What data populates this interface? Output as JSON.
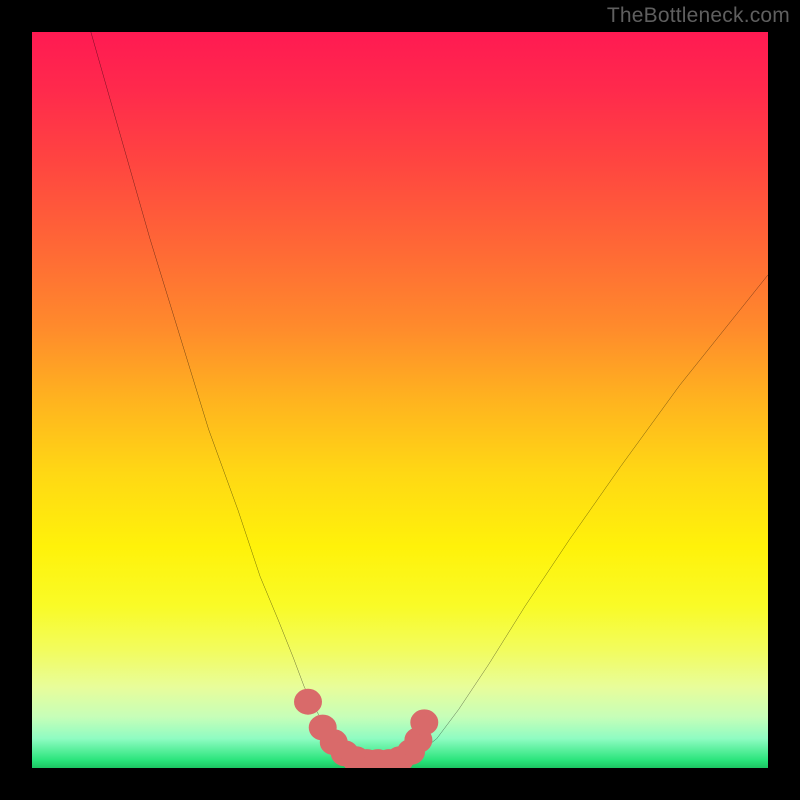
{
  "watermark": "TheBottleneck.com",
  "chart_data": {
    "type": "line",
    "title": "",
    "xlabel": "",
    "ylabel": "",
    "xlim": [
      0,
      100
    ],
    "ylim": [
      0,
      100
    ],
    "grid": false,
    "legend": false,
    "series": [
      {
        "name": "bottleneck-curve",
        "color": "#000000",
        "x": [
          8,
          12,
          16,
          20,
          24,
          28,
          31,
          33.5,
          35.5,
          37,
          38.5,
          40,
          41.5,
          43,
          45,
          48,
          51,
          52.5,
          55,
          58,
          62,
          67,
          73,
          80,
          88,
          96,
          100
        ],
        "y": [
          100,
          86,
          72,
          59,
          46,
          35,
          26,
          20,
          15,
          11,
          8,
          5.5,
          3.5,
          2,
          1,
          0.5,
          1,
          2,
          4,
          8,
          14,
          22,
          31,
          41,
          52,
          62,
          67
        ]
      },
      {
        "name": "highlight-dots",
        "color": "#d96a6a",
        "marker_radius": 1.4,
        "x": [
          37.5,
          39.5,
          41,
          42.5,
          44,
          45.5,
          47,
          48.5,
          50,
          51.5,
          52.5,
          53.3
        ],
        "y": [
          9,
          5.5,
          3.5,
          2,
          1.2,
          0.8,
          0.8,
          0.8,
          1.2,
          2.2,
          3.8,
          6.2
        ]
      }
    ],
    "background_gradient": {
      "stops": [
        {
          "pos": 0.0,
          "color": "#ff1a52"
        },
        {
          "pos": 0.3,
          "color": "#ff6a35"
        },
        {
          "pos": 0.6,
          "color": "#ffd814"
        },
        {
          "pos": 0.84,
          "color": "#f2fc5e"
        },
        {
          "pos": 0.96,
          "color": "#8ffcc2"
        },
        {
          "pos": 1.0,
          "color": "#1cc562"
        }
      ]
    }
  }
}
